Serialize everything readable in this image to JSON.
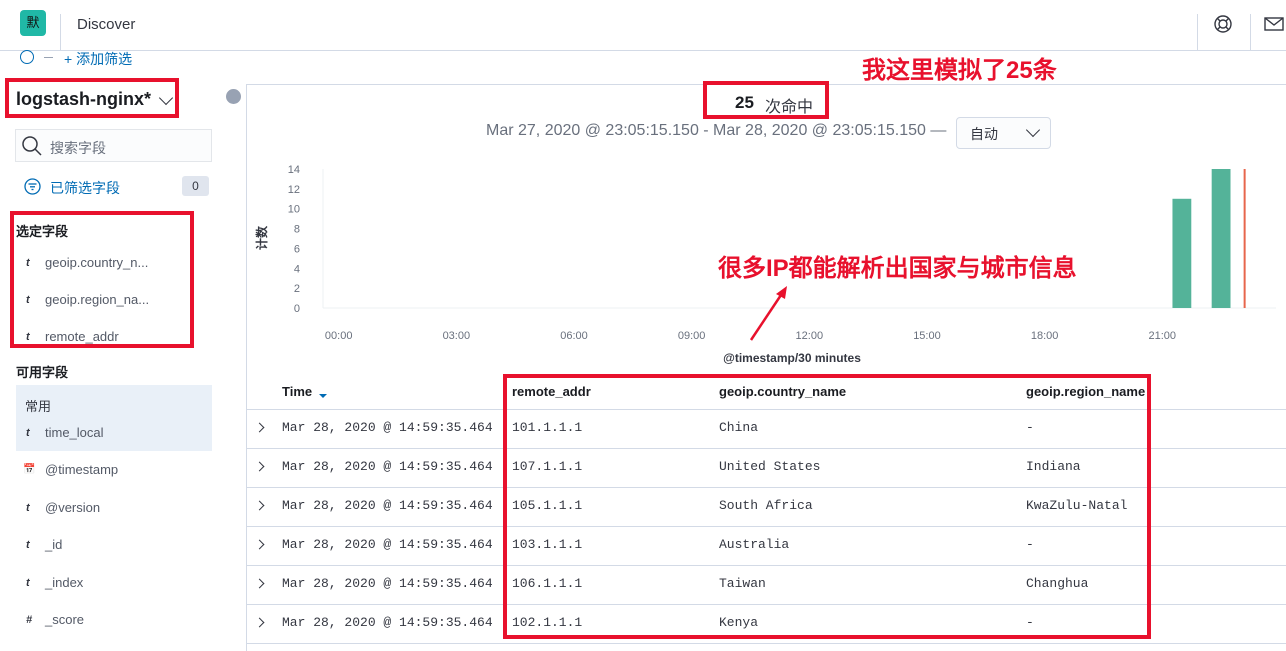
{
  "header": {
    "logo_char": "默",
    "title": "Discover",
    "help_icon": "help-icon",
    "mail_icon": "mail-icon"
  },
  "filter_bar": {
    "add_filter": "+ 添加筛选"
  },
  "sidebar": {
    "index_pattern": "logstash-nginx*",
    "search_placeholder": "搜索字段",
    "filtered_fields_label": "已筛选字段",
    "filtered_fields_count": "0",
    "selected_title": "选定字段",
    "selected_fields": [
      {
        "type": "t",
        "name": "geoip.country_n..."
      },
      {
        "type": "t",
        "name": "geoip.region_na..."
      },
      {
        "type": "t",
        "name": "remote_addr"
      }
    ],
    "available_title": "可用字段",
    "common_title": "常用",
    "available_fields": [
      {
        "type": "t",
        "name": "time_local"
      },
      {
        "type": "📅",
        "name": "@timestamp"
      },
      {
        "type": "t",
        "name": "@version"
      },
      {
        "type": "t",
        "name": "_id"
      },
      {
        "type": "t",
        "name": "_index"
      },
      {
        "type": "#",
        "name": "_score"
      }
    ]
  },
  "hits": {
    "count": "25",
    "label": "次命中"
  },
  "timerange": {
    "text": "Mar 27, 2020 @ 23:05:15.150 - Mar 28, 2020 @ 23:05:15.150 —",
    "interval": "自动"
  },
  "chart_data": {
    "type": "bar",
    "xlabel": "@timestamp/30 minutes",
    "ylabel": "计数",
    "ylim": [
      0,
      14
    ],
    "y_ticks": [
      "0",
      "2",
      "4",
      "6",
      "8",
      "10",
      "12",
      "14"
    ],
    "x_ticks": [
      "00:00",
      "03:00",
      "06:00",
      "09:00",
      "12:00",
      "15:00",
      "18:00",
      "21:00"
    ],
    "x_domain_hours": [
      -0.4,
      23.9
    ],
    "bars": [
      {
        "hour": 21.5,
        "value": 11
      },
      {
        "hour": 22.5,
        "value": 14
      }
    ],
    "now_marker_hour": 23.1,
    "bar_color": "#54b399",
    "marker_color": "#e7664c"
  },
  "table": {
    "columns": [
      "Time",
      "remote_addr",
      "geoip.country_name",
      "geoip.region_name"
    ],
    "rows": [
      {
        "time": "Mar 28, 2020 @ 14:59:35.464",
        "addr": "101.1.1.1",
        "country": "China",
        "region": " -"
      },
      {
        "time": "Mar 28, 2020 @ 14:59:35.464",
        "addr": "107.1.1.1",
        "country": "United States",
        "region": "Indiana"
      },
      {
        "time": "Mar 28, 2020 @ 14:59:35.464",
        "addr": "105.1.1.1",
        "country": "South Africa",
        "region": "KwaZulu-Natal"
      },
      {
        "time": "Mar 28, 2020 @ 14:59:35.464",
        "addr": "103.1.1.1",
        "country": "Australia",
        "region": " -"
      },
      {
        "time": "Mar 28, 2020 @ 14:59:35.464",
        "addr": "106.1.1.1",
        "country": "Taiwan",
        "region": "Changhua"
      },
      {
        "time": "Mar 28, 2020 @ 14:59:35.464",
        "addr": "102.1.1.1",
        "country": "Kenya",
        "region": " -"
      }
    ]
  },
  "annotations": {
    "top_note": "我这里模拟了25条",
    "mid_note": "很多IP都能解析出国家与城市信息"
  }
}
